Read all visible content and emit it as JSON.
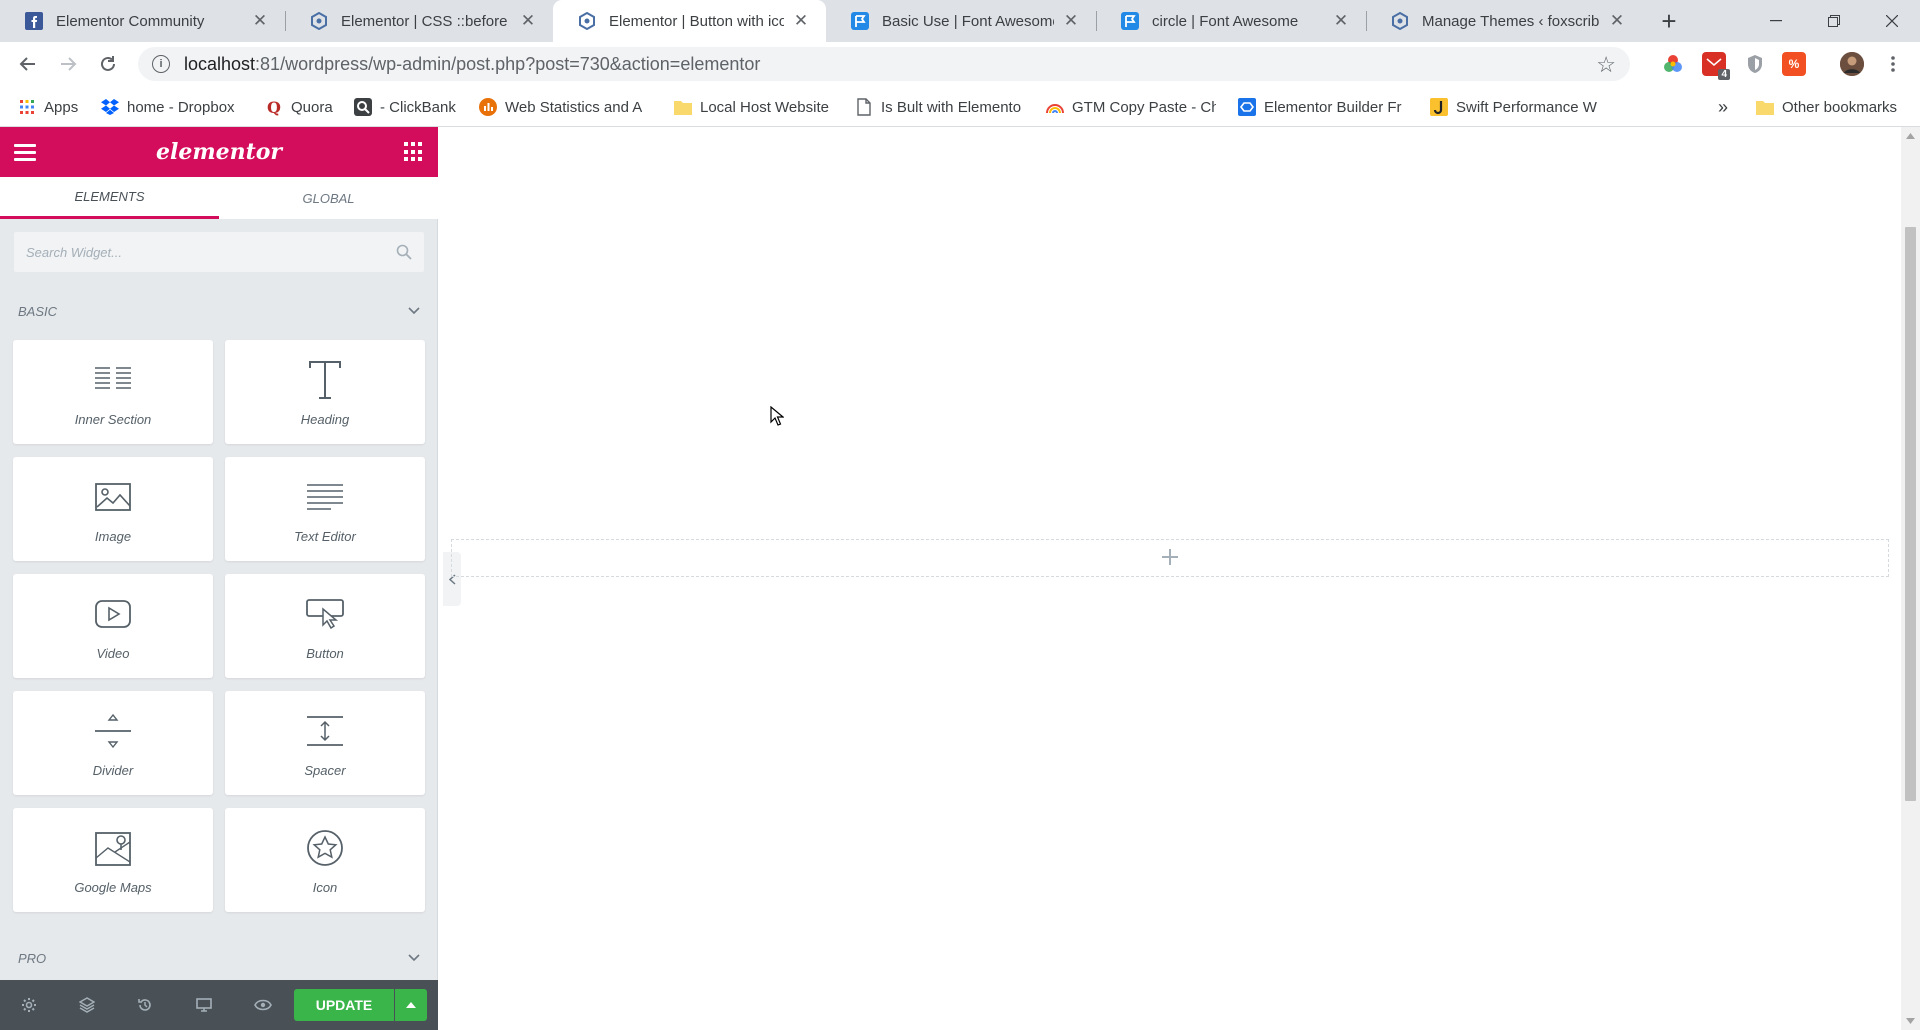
{
  "browser": {
    "tabs": [
      {
        "title": "Elementor Community",
        "favicon": "facebook-icon"
      },
      {
        "title": "Elementor | CSS ::before and",
        "favicon": "elementor-hex-icon"
      },
      {
        "title": "Elementor | Button with icon",
        "favicon": "elementor-hex-icon",
        "active": true
      },
      {
        "title": "Basic Use | Font Awesome",
        "favicon": "font-awesome-flag-icon"
      },
      {
        "title": "circle | Font Awesome",
        "favicon": "font-awesome-flag-icon"
      },
      {
        "title": "Manage Themes ‹ foxscribble",
        "favicon": "elementor-hex-icon"
      }
    ],
    "url": {
      "host": "localhost",
      "rest": ":81/wordpress/wp-admin/post.php?post=730&action=elementor"
    },
    "extension_badge": "4",
    "bookmarks": [
      {
        "label": "Apps",
        "icon": "apps-grid-icon"
      },
      {
        "label": "home - Dropbox",
        "icon": "dropbox-icon"
      },
      {
        "label": "Quora",
        "icon": "quora-icon"
      },
      {
        "label": "- ClickBank",
        "icon": "clickbank-icon"
      },
      {
        "label": "Web Statistics and A",
        "icon": "stats-icon"
      },
      {
        "label": "Local Host Website",
        "icon": "folder-icon"
      },
      {
        "label": "Is Bult with Elemento",
        "icon": "page-icon"
      },
      {
        "label": "GTM Copy Paste - Ch",
        "icon": "rainbow-icon"
      },
      {
        "label": "Elementor Builder Fr",
        "icon": "builder-icon"
      },
      {
        "label": "Swift Performance W",
        "icon": "swift-icon"
      }
    ],
    "bookmarks_more": "»",
    "other_bookmarks": "Other bookmarks"
  },
  "panel": {
    "logo": "elementor",
    "tabs": [
      {
        "label": "ELEMENTS",
        "active": true
      },
      {
        "label": "GLOBAL",
        "active": false
      }
    ],
    "search_placeholder": "Search Widget...",
    "categories": {
      "basic": "BASIC",
      "pro": "PRO"
    },
    "widgets": [
      {
        "label": "Inner Section",
        "icon": "inner-section-icon"
      },
      {
        "label": "Heading",
        "icon": "heading-icon"
      },
      {
        "label": "Image",
        "icon": "image-icon"
      },
      {
        "label": "Text Editor",
        "icon": "text-editor-icon"
      },
      {
        "label": "Video",
        "icon": "video-icon"
      },
      {
        "label": "Button",
        "icon": "button-icon"
      },
      {
        "label": "Divider",
        "icon": "divider-icon"
      },
      {
        "label": "Spacer",
        "icon": "spacer-icon"
      },
      {
        "label": "Google Maps",
        "icon": "google-maps-icon"
      },
      {
        "label": "Icon",
        "icon": "star-icon"
      }
    ],
    "update_label": "UPDATE"
  },
  "colors": {
    "brand": "#d30c5c",
    "update": "#39b54a",
    "footer": "#495157",
    "panel_bg": "#e6e9ec"
  }
}
